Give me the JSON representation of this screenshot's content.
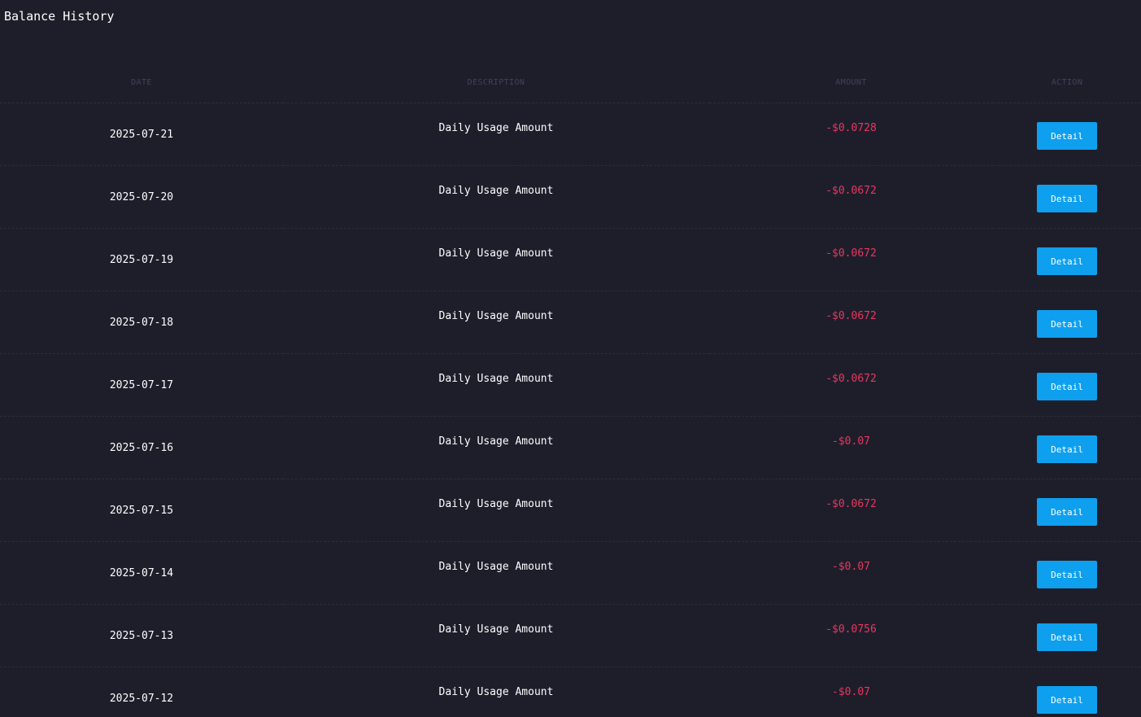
{
  "page": {
    "title": "Balance History"
  },
  "table": {
    "headers": {
      "date": "DATE",
      "description": "DESCRIPTION",
      "amount": "AMOUNT",
      "action": "ACTION"
    },
    "rows": [
      {
        "date": "2025-07-21",
        "description": "Daily Usage Amount",
        "amount": "-$0.0728",
        "action": "Detail"
      },
      {
        "date": "2025-07-20",
        "description": "Daily Usage Amount",
        "amount": "-$0.0672",
        "action": "Detail"
      },
      {
        "date": "2025-07-19",
        "description": "Daily Usage Amount",
        "amount": "-$0.0672",
        "action": "Detail"
      },
      {
        "date": "2025-07-18",
        "description": "Daily Usage Amount",
        "amount": "-$0.0672",
        "action": "Detail"
      },
      {
        "date": "2025-07-17",
        "description": "Daily Usage Amount",
        "amount": "-$0.0672",
        "action": "Detail"
      },
      {
        "date": "2025-07-16",
        "description": "Daily Usage Amount",
        "amount": "-$0.07",
        "action": "Detail"
      },
      {
        "date": "2025-07-15",
        "description": "Daily Usage Amount",
        "amount": "-$0.0672",
        "action": "Detail"
      },
      {
        "date": "2025-07-14",
        "description": "Daily Usage Amount",
        "amount": "-$0.07",
        "action": "Detail"
      },
      {
        "date": "2025-07-13",
        "description": "Daily Usage Amount",
        "amount": "-$0.0756",
        "action": "Detail"
      },
      {
        "date": "2025-07-12",
        "description": "Daily Usage Amount",
        "amount": "-$0.07",
        "action": "Detail"
      }
    ]
  },
  "colors": {
    "background": "#1e1e2b",
    "text": "#ffffff",
    "header_text": "#3f4356",
    "negative_amount": "#e8375e",
    "button": "#0ea0ee",
    "row_divider": "#2b2c3c"
  }
}
